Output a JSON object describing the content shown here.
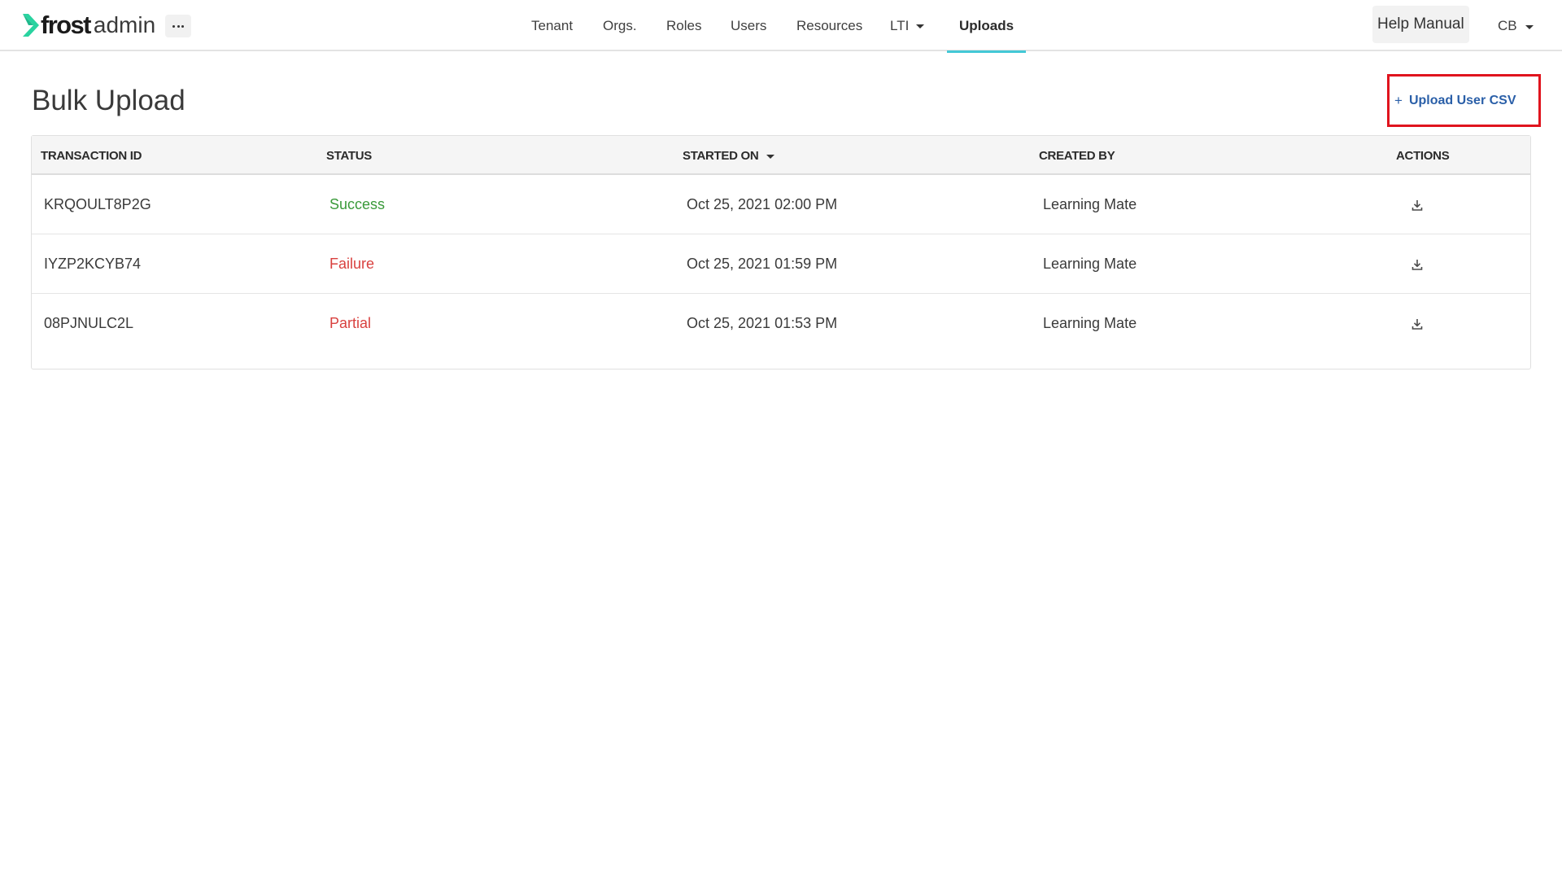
{
  "brand": {
    "word1": "frost",
    "word2": "admin",
    "accent_color": "#2ad3a0"
  },
  "nav": {
    "items": [
      {
        "label": "Tenant"
      },
      {
        "label": "Orgs."
      },
      {
        "label": "Roles"
      },
      {
        "label": "Users"
      },
      {
        "label": "Resources"
      },
      {
        "label": "LTI",
        "has_dropdown": true
      },
      {
        "label": "Uploads",
        "active": true
      }
    ],
    "active_underline_color": "#43c8d6"
  },
  "header_right": {
    "help_label": "Help Manual",
    "user_initials": "CB"
  },
  "page": {
    "title": "Bulk Upload",
    "upload_button": {
      "icon": "plus-icon",
      "label": "Upload User CSV",
      "color": "#2a5fa8"
    }
  },
  "table": {
    "columns": [
      {
        "label": "TRANSACTION ID"
      },
      {
        "label": "STATUS"
      },
      {
        "label": "STARTED ON",
        "sorted": "desc"
      },
      {
        "label": "CREATED BY"
      },
      {
        "label": "ACTIONS"
      }
    ],
    "rows": [
      {
        "transaction_id": "KRQOULT8P2G",
        "status": "Success",
        "started_on": "Oct 25, 2021 02:00 PM",
        "created_by": "Learning Mate",
        "action_icon": "download-icon"
      },
      {
        "transaction_id": "IYZP2KCYB74",
        "status": "Failure",
        "started_on": "Oct 25, 2021 01:59 PM",
        "created_by": "Learning Mate",
        "action_icon": "download-icon"
      },
      {
        "transaction_id": "08PJNULC2L",
        "status": "Partial",
        "started_on": "Oct 25, 2021 01:53 PM",
        "created_by": "Learning Mate",
        "action_icon": "download-icon"
      }
    ],
    "status_colors": {
      "Success": "#3a9a3a",
      "Failure": "#d9413f",
      "Partial": "#d9413f"
    }
  }
}
